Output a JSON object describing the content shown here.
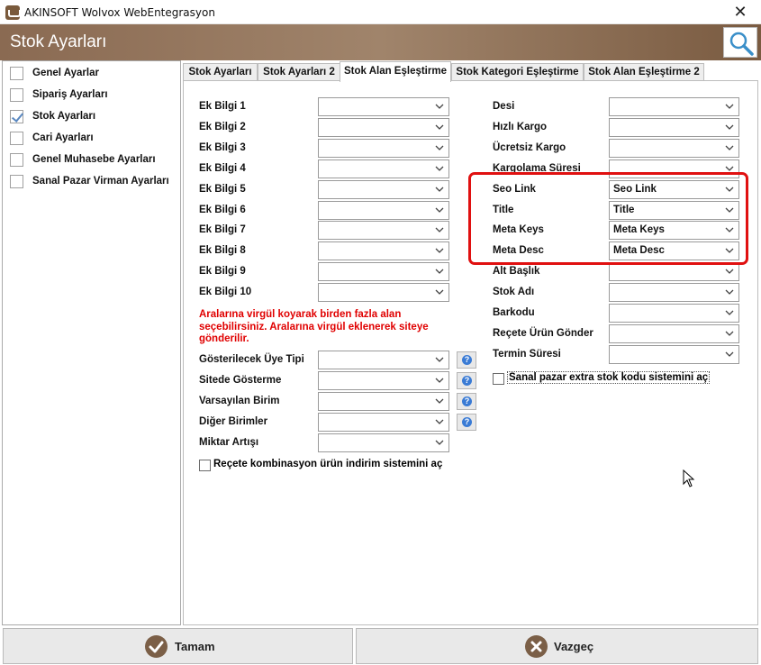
{
  "window": {
    "title": "AKINSOFT Wolvox WebEntegrasyon",
    "close_glyph": "✕"
  },
  "header": {
    "title": "Stok Ayarları",
    "search_icon": "magnifier-icon"
  },
  "sidebar": {
    "items": [
      {
        "label": "Genel Ayarlar",
        "checked": false
      },
      {
        "label": "Sipariş Ayarları",
        "checked": false
      },
      {
        "label": "Stok Ayarları",
        "checked": true
      },
      {
        "label": "Cari Ayarları",
        "checked": false
      },
      {
        "label": "Genel Muhasebe Ayarları",
        "checked": false
      },
      {
        "label": "Sanal Pazar Virman Ayarları",
        "checked": false
      }
    ]
  },
  "tabs": [
    {
      "label": "Stok Ayarları",
      "active": false
    },
    {
      "label": "Stok Ayarları 2",
      "active": false
    },
    {
      "label": "Stok Alan Eşleştirme",
      "active": true
    },
    {
      "label": "Stok Kategori Eşleştirme",
      "active": false
    },
    {
      "label": "Stok Alan Eşleştirme 2",
      "active": false
    }
  ],
  "left_fields": [
    {
      "label": "Ek Bilgi 1",
      "value": ""
    },
    {
      "label": "Ek Bilgi 2",
      "value": ""
    },
    {
      "label": "Ek Bilgi 3",
      "value": ""
    },
    {
      "label": "Ek Bilgi 4",
      "value": ""
    },
    {
      "label": "Ek Bilgi 5",
      "value": ""
    },
    {
      "label": "Ek Bilgi 6",
      "value": ""
    },
    {
      "label": "Ek Bilgi 7",
      "value": ""
    },
    {
      "label": "Ek Bilgi 8",
      "value": ""
    },
    {
      "label": "Ek Bilgi 9",
      "value": ""
    },
    {
      "label": "Ek Bilgi 10",
      "value": ""
    }
  ],
  "warning_text": "Aralarına virgül koyarak birden fazla alan seçebilirsiniz. Aralarına virgül  eklenerek siteye gönderilir.",
  "left_fields_2": [
    {
      "label": "Gösterilecek Üye Tipi",
      "value": "",
      "help": true
    },
    {
      "label": "Sitede Gösterme",
      "value": "",
      "help": true
    },
    {
      "label": "Varsayılan Birim",
      "value": "",
      "help": true
    },
    {
      "label": "Diğer Birimler",
      "value": "",
      "help": true
    },
    {
      "label": "Miktar Artışı",
      "value": "",
      "help": false
    }
  ],
  "recete_checkbox": {
    "label": "Reçete kombinasyon ürün indirim sistemini aç",
    "checked": false
  },
  "right_fields": [
    {
      "label": "Desi",
      "value": ""
    },
    {
      "label": "Hızlı Kargo",
      "value": ""
    },
    {
      "label": "Ücretsiz Kargo",
      "value": ""
    },
    {
      "label": "Kargolama Süresi",
      "value": ""
    },
    {
      "label": "Seo Link",
      "value": "Seo Link"
    },
    {
      "label": "Title",
      "value": "Title"
    },
    {
      "label": "Meta Keys",
      "value": "Meta Keys"
    },
    {
      "label": "Meta Desc",
      "value": "Meta Desc"
    },
    {
      "label": "Alt Başlık",
      "value": ""
    },
    {
      "label": "Stok Adı",
      "value": ""
    },
    {
      "label": "Barkodu",
      "value": ""
    },
    {
      "label": "Reçete Ürün Gönder",
      "value": ""
    },
    {
      "label": "Termin Süresi",
      "value": ""
    }
  ],
  "sanal_checkbox": {
    "label": "Sanal pazar extra stok kodu sistemini aç",
    "checked": false
  },
  "buttons": {
    "ok": "Tamam",
    "cancel": "Vazgeç"
  },
  "colors": {
    "accent_red": "#e01010",
    "warning_red": "#e00000",
    "header_brown": "#8a6a52"
  }
}
